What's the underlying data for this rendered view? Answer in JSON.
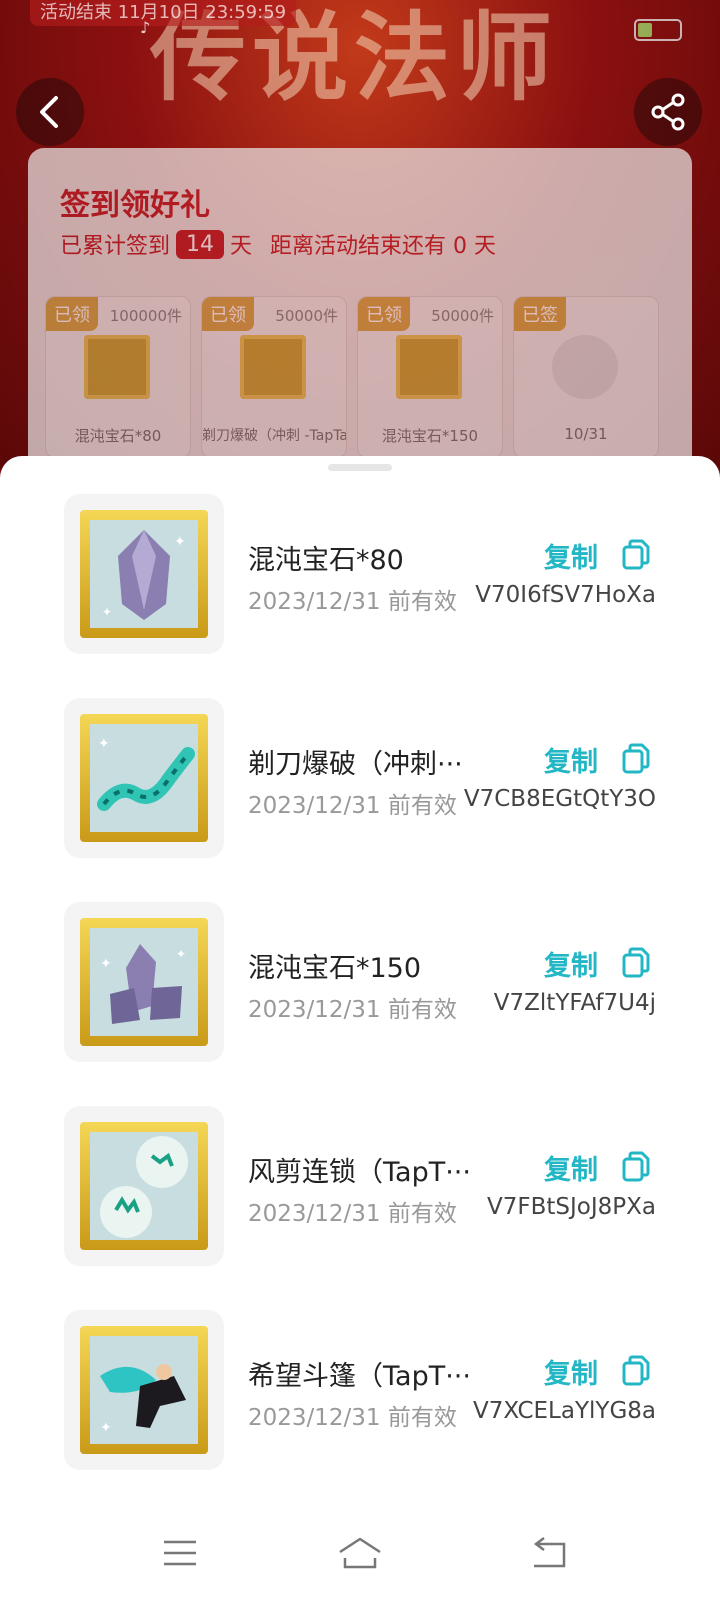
{
  "status_bar": {
    "event_end_text": "活动结束 11月10日 23:59:59"
  },
  "banner": {
    "title": "传说法师"
  },
  "checkin": {
    "title": "签到领好礼",
    "prefix": "已累计签到",
    "days": "14",
    "day_unit": "天",
    "remaining_text": "距离活动结束还有 0 天",
    "rewards": [
      {
        "tag": "已领",
        "count": "100000件",
        "name": "混沌宝石*80"
      },
      {
        "tag": "已领",
        "count": "50000件",
        "name": "剃刀爆破（冲刺 -TapTap联动…"
      },
      {
        "tag": "已领",
        "count": "50000件",
        "name": "混沌宝石*150"
      },
      {
        "tag": "已签",
        "count": "",
        "name": "10/31"
      }
    ]
  },
  "codes": [
    {
      "name": "混沌宝石*80",
      "expiry": "2023/12/31 前有效",
      "code": "V70I6fSV7HoXa",
      "copy_label": "复制"
    },
    {
      "name": "剃刀爆破（冲刺···",
      "expiry": "2023/12/31 前有效",
      "code": "V7CB8EGtQtY3O",
      "copy_label": "复制"
    },
    {
      "name": "混沌宝石*150",
      "expiry": "2023/12/31 前有效",
      "code": "V7ZltYFAf7U4j",
      "copy_label": "复制"
    },
    {
      "name": "风剪连锁（TapT···",
      "expiry": "2023/12/31 前有效",
      "code": "V7FBtSJoJ8PXa",
      "copy_label": "复制"
    },
    {
      "name": "希望斗篷（TapT···",
      "expiry": "2023/12/31 前有效",
      "code": "V7XCELaYlYG8a",
      "copy_label": "复制"
    }
  ],
  "colors": {
    "accent": "#23b7c6",
    "brand_red": "#c0202a",
    "gold": "#d6a94c"
  },
  "icons": [
    "back-icon",
    "share-icon",
    "copy-icon",
    "menu-icon",
    "home-icon",
    "back-nav-icon"
  ]
}
